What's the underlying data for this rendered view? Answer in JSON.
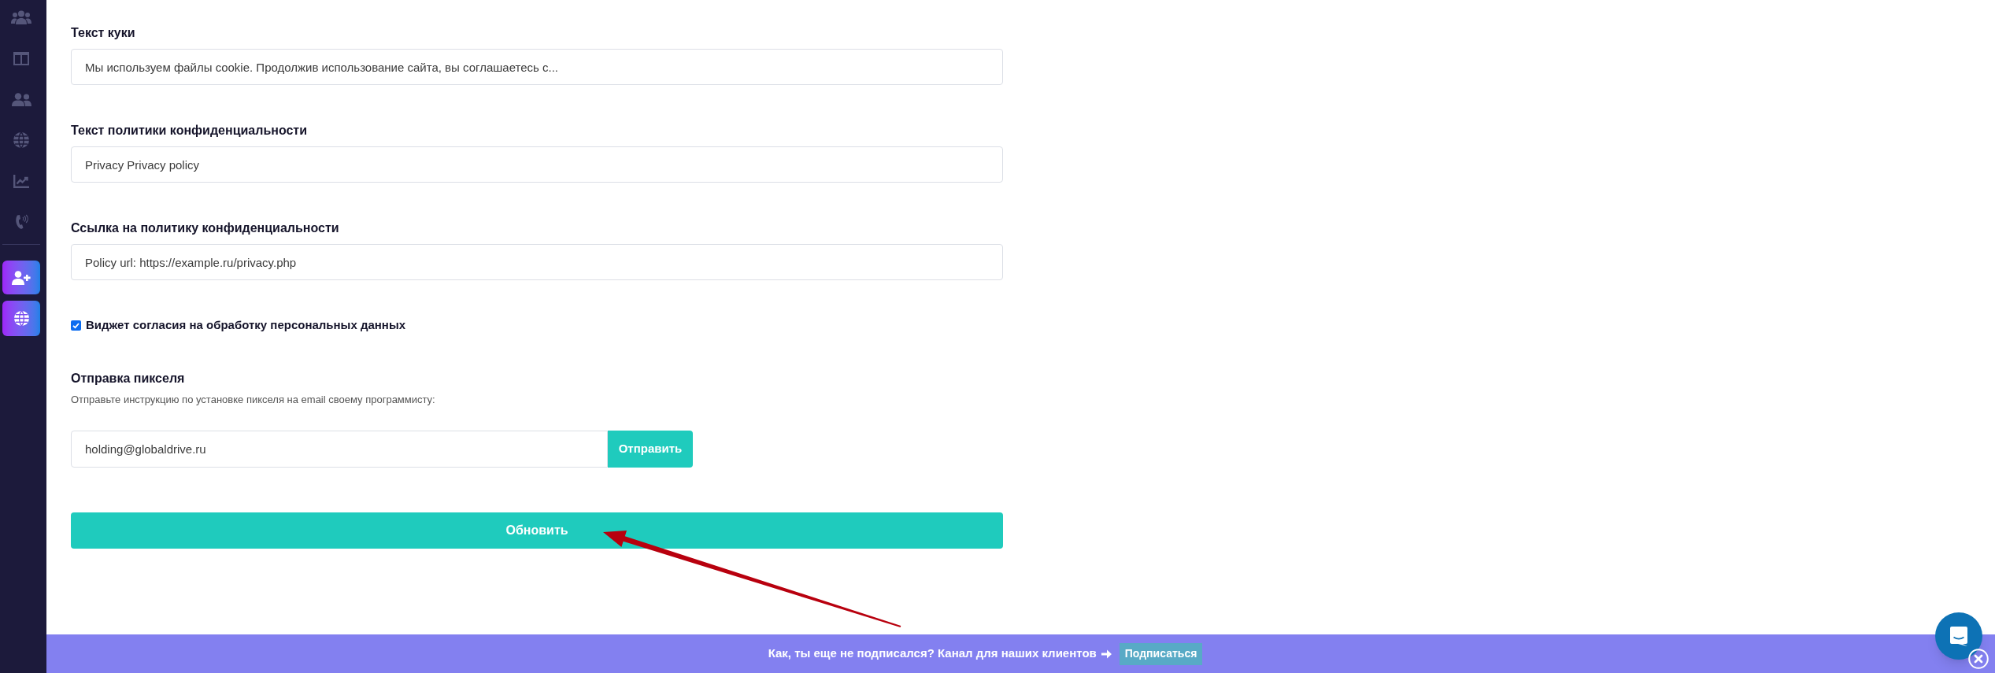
{
  "form": {
    "fields": [
      {
        "label": "Текст куки",
        "value": "Мы используем файлы cookie. Продолжив использование сайта, вы соглашаетесь с..."
      },
      {
        "label": "Текст политики конфиденциальности",
        "value": "Privacy Privacy policy"
      },
      {
        "label": "Ссылка на политику конфиденциальности",
        "value": "Policy url: https://example.ru/privacy.php"
      }
    ],
    "consent_checkbox": {
      "label": "Виджет согласия на обработку персональных данных",
      "checked": true
    },
    "pixel": {
      "title": "Отправка пикселя",
      "description": "Отправьте инструкцию по установке пикселя на email своему программисту:",
      "email": "holding@globaldrive.ru",
      "button": "Отправить"
    },
    "submit_button": "Обновить"
  },
  "banner": {
    "text": "Как, ты еще не подписался? Канал для наших клиентов",
    "button": "Подписаться"
  }
}
